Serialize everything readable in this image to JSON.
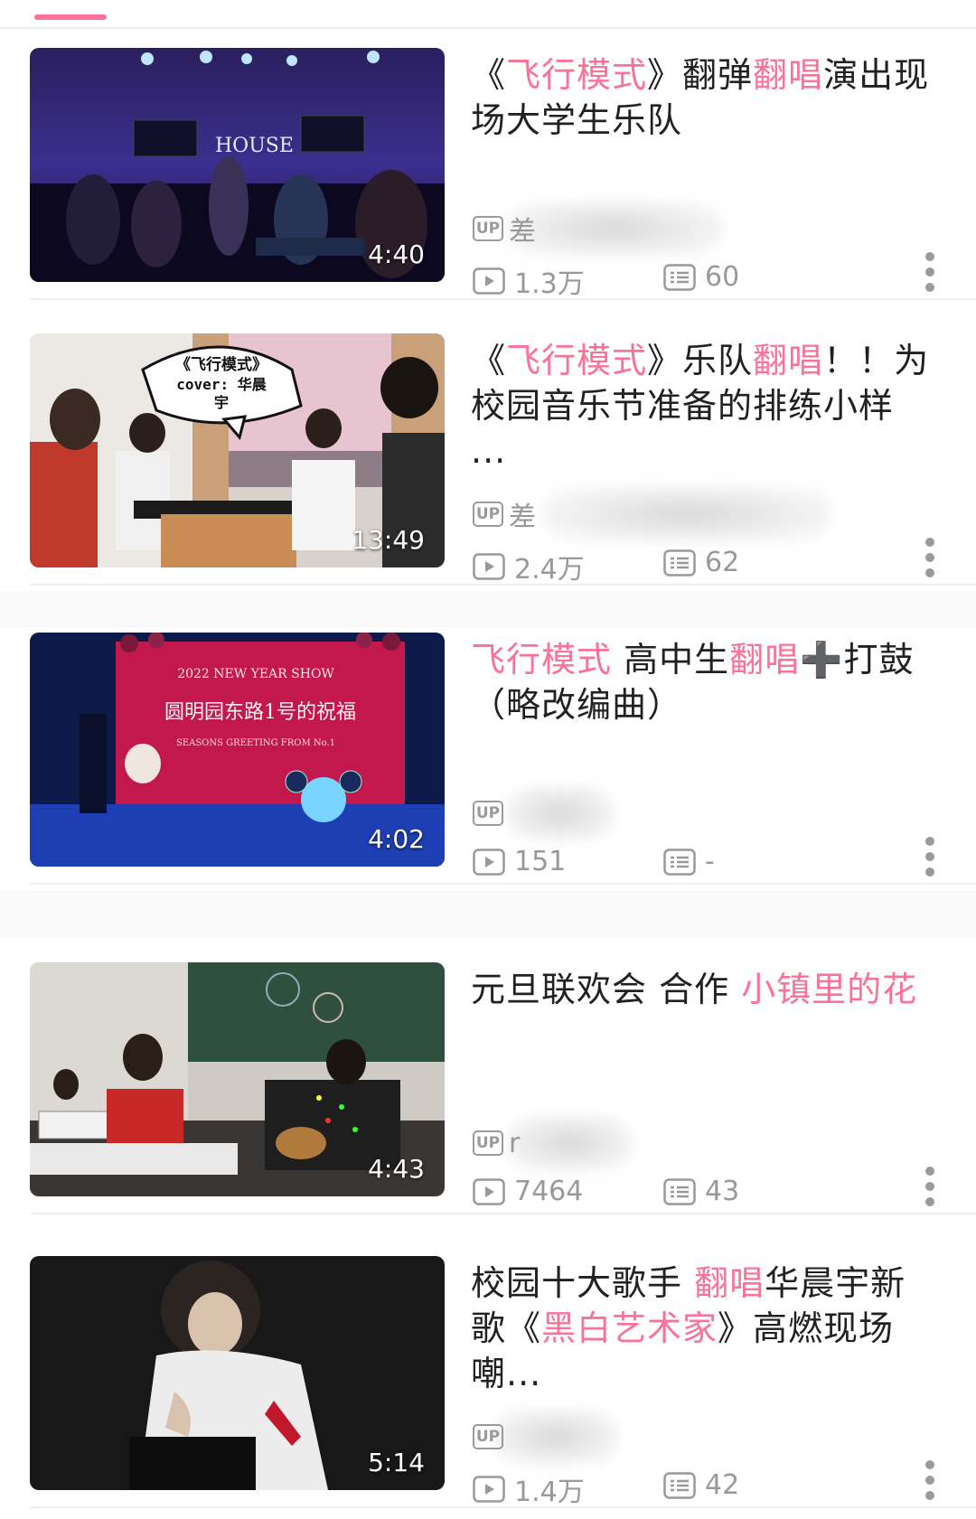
{
  "colors": {
    "accent": "#fb7299",
    "meta": "#999999",
    "title": "#212121"
  },
  "videos": [
    {
      "title_parts": [
        [
          "《",
          "n"
        ],
        [
          "飞行模式",
          "h"
        ],
        [
          "》翻弹",
          "n"
        ],
        [
          "翻唱",
          "h"
        ],
        [
          "演出现场大学生乐队",
          "n"
        ]
      ],
      "duration": "4:40",
      "uploader": "差",
      "plays": "1.3万",
      "danmaku": "60"
    },
    {
      "title_parts": [
        [
          "《",
          "n"
        ],
        [
          "飞行模式",
          "h"
        ],
        [
          "》乐队",
          "n"
        ],
        [
          "翻唱",
          "h"
        ],
        [
          "！！为校园音乐节准备的排练小样 ...",
          "n"
        ]
      ],
      "duration": "13:49",
      "uploader": "差",
      "plays": "2.4万",
      "danmaku": "62",
      "thumb_caption": "《飞行模式》cover：华晨宇"
    },
    {
      "title_parts": [
        [
          "飞行模式",
          "h"
        ],
        [
          " 高中生",
          "n"
        ],
        [
          "翻唱",
          "h"
        ],
        [
          "➕",
          "p"
        ],
        [
          "打鼓（略改编曲）",
          "n"
        ]
      ],
      "duration": "4:02",
      "uploader": "",
      "plays": "151",
      "danmaku": "-",
      "thumb_caption": "圆明园东路1号的祝福"
    },
    {
      "title_parts": [
        [
          "元旦联欢会 合作 ",
          "n"
        ],
        [
          "小镇里的花",
          "h"
        ]
      ],
      "duration": "4:43",
      "uploader": "r",
      "plays": "7464",
      "danmaku": "43"
    },
    {
      "title_parts": [
        [
          "校园十大歌手 ",
          "n"
        ],
        [
          "翻唱",
          "h"
        ],
        [
          "华晨宇新歌《",
          "n"
        ],
        [
          "黑白艺术家",
          "h"
        ],
        [
          "》高燃现场 嘲...",
          "n"
        ]
      ],
      "duration": "5:14",
      "uploader": "",
      "plays": "1.4万",
      "danmaku": "42"
    }
  ]
}
